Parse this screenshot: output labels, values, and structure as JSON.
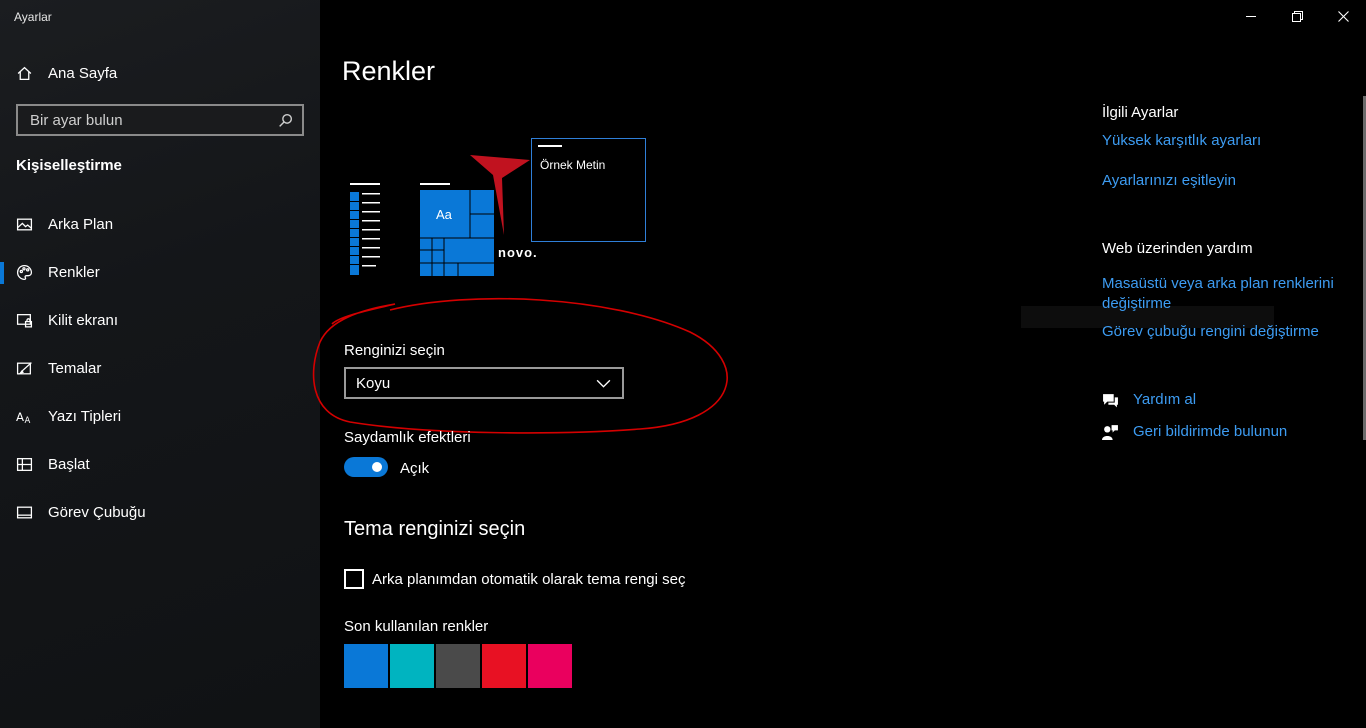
{
  "window": {
    "app_title": "Ayarlar",
    "controls": [
      "minimize-icon",
      "maximize-icon",
      "close-icon"
    ]
  },
  "sidebar": {
    "home_label": "Ana Sayfa",
    "search_placeholder": "Bir ayar bulun",
    "section_title": "Kişiselleştirme",
    "items": [
      {
        "label": "Arka Plan",
        "icon": "picture-icon",
        "active": false
      },
      {
        "label": "Renkler",
        "icon": "palette-icon",
        "active": true
      },
      {
        "label": "Kilit ekranı",
        "icon": "lock-screen-icon",
        "active": false
      },
      {
        "label": "Temalar",
        "icon": "themes-icon",
        "active": false
      },
      {
        "label": "Yazı Tipleri",
        "icon": "fonts-icon",
        "active": false
      },
      {
        "label": "Başlat",
        "icon": "start-icon",
        "active": false
      },
      {
        "label": "Görev Çubuğu",
        "icon": "taskbar-icon",
        "active": false
      }
    ]
  },
  "main": {
    "title": "Renkler",
    "preview": {
      "sample_text": "Örnek Metin",
      "tile_text": "Aa",
      "wallpaper_text": "novo."
    },
    "choose_color": {
      "label": "Renginizi seçin",
      "value": "Koyu"
    },
    "transparency": {
      "label": "Saydamlık efektleri",
      "state": "Açık"
    },
    "theme_color_title": "Tema renginizi seçin",
    "auto_checkbox_label": "Arka planımdan otomatik olarak tema rengi seç",
    "recent_colors_title": "Son kullanılan renkler",
    "recent_colors": [
      "#0a78d7",
      "#00b4c0",
      "#4a4a4a",
      "#e81123",
      "#ea005e"
    ],
    "accent_color": "#0a78d7",
    "annotation_color": "#d40000"
  },
  "right": {
    "related_title": "İlgili Ayarlar",
    "related_links": [
      "Yüksek karşıtlık ayarları",
      "Ayarlarınızı eşitleyin"
    ],
    "web_help_title": "Web üzerinden yardım",
    "web_links": [
      "Masaüstü veya arka plan renklerini değiştirme",
      "Görev çubuğu rengini değiştirme"
    ],
    "help_label": "Yardım al",
    "feedback_label": "Geri bildirimde bulunun"
  }
}
